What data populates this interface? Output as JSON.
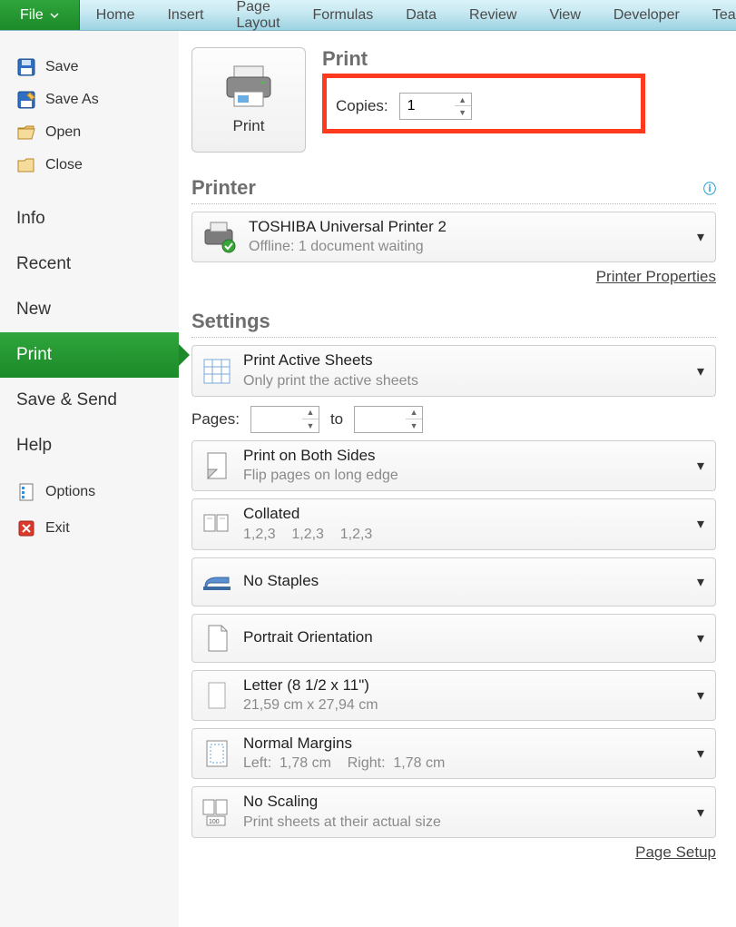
{
  "ribbon": {
    "tabs": [
      "File",
      "Home",
      "Insert",
      "Page Layout",
      "Formulas",
      "Data",
      "Review",
      "View",
      "Developer",
      "Team"
    ],
    "active": "File"
  },
  "sidebar": {
    "quick": [
      {
        "icon": "save",
        "label": "Save"
      },
      {
        "icon": "saveas",
        "label": "Save As"
      },
      {
        "icon": "open",
        "label": "Open"
      },
      {
        "icon": "close",
        "label": "Close"
      }
    ],
    "menu": [
      {
        "label": "Info"
      },
      {
        "label": "Recent"
      },
      {
        "label": "New"
      },
      {
        "label": "Print",
        "active": true
      },
      {
        "label": "Save & Send"
      },
      {
        "label": "Help"
      }
    ],
    "bottom": [
      {
        "icon": "options",
        "label": "Options"
      },
      {
        "icon": "exit",
        "label": "Exit"
      }
    ]
  },
  "print": {
    "button_label": "Print",
    "header": "Print",
    "copies_label": "Copies:",
    "copies_value": "1"
  },
  "printer": {
    "header": "Printer",
    "name": "TOSHIBA Universal Printer 2",
    "status": "Offline: 1 document waiting",
    "properties_link": "Printer Properties"
  },
  "settings": {
    "header": "Settings",
    "pages_label": "Pages:",
    "pages_from": "",
    "pages_to_label": "to",
    "pages_to": "",
    "items": [
      {
        "icon": "sheets",
        "title": "Print Active Sheets",
        "sub": "Only print the active sheets"
      },
      {
        "icon": "duplex",
        "title": "Print on Both Sides",
        "sub": "Flip pages on long edge"
      },
      {
        "icon": "collate",
        "title": "Collated",
        "sub": "1,2,3    1,2,3    1,2,3"
      },
      {
        "icon": "staple",
        "title": "No Staples",
        "sub": ""
      },
      {
        "icon": "portrait",
        "title": "Portrait Orientation",
        "sub": ""
      },
      {
        "icon": "paper",
        "title": "Letter (8 1/2 x 11\")",
        "sub": "21,59 cm x 27,94 cm"
      },
      {
        "icon": "margins",
        "title": "Normal Margins",
        "sub": "Left:  1,78 cm    Right:  1,78 cm"
      },
      {
        "icon": "scale",
        "title": "No Scaling",
        "sub": "Print sheets at their actual size"
      }
    ],
    "page_setup_link": "Page Setup"
  }
}
